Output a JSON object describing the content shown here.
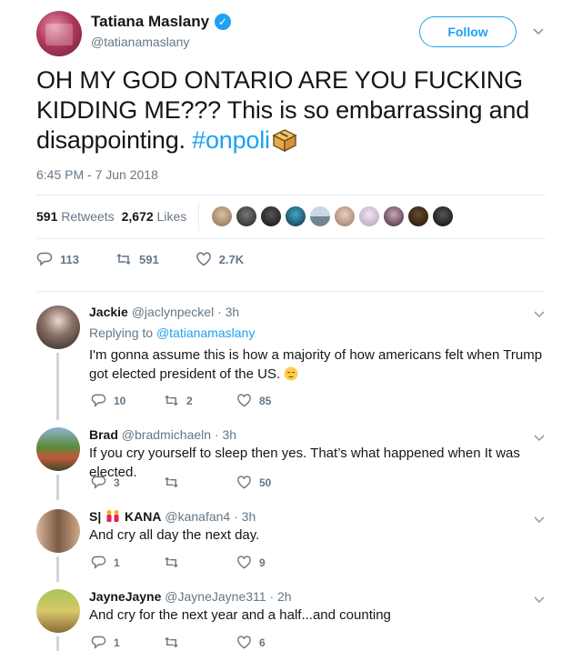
{
  "tweet": {
    "display_name": "Tatiana Maslany",
    "handle": "@tatianamaslany",
    "follow_label": "Follow",
    "text_main": "OH MY GOD ONTARIO ARE YOU FUCKING KIDDING ME??? This is so embarrassing and disappointing. ",
    "hashtag": "#onpoli",
    "timestamp": "6:45 PM - 7 Jun 2018",
    "retweets_count": "591",
    "retweets_label": "Retweets",
    "likes_count": "2,672",
    "likes_label": "Likes",
    "reply_count": "113",
    "retweet_count_action": "591",
    "like_count_action": "2.7K",
    "brand_color": "#1da1f2",
    "verified_icon": "verified-badge-icon",
    "hashtag_emoji": "ballot-box-icon"
  },
  "replies": [
    {
      "name": "Jackie",
      "handle": "@jaclynpeckel",
      "time": "· 3h",
      "replying_prefix": "Replying to",
      "replying_handle": "@tatianamaslany",
      "text": "I'm gonna assume this is how a majority of how americans felt when Trump got elected president of the US. ",
      "replies": "10",
      "retweets": "2",
      "likes": "85"
    },
    {
      "name": "Brad",
      "handle": "@bradmichaeln",
      "time": "· 3h",
      "text": "If you cry yourself to sleep then yes. That’s what happened when It was elected.",
      "replies": "3",
      "retweets": "",
      "likes": "50"
    },
    {
      "name": "S|",
      "name_suffix": "KANA",
      "handle": "@kanafan4",
      "time": "· 3h",
      "text": "And cry all day the next day.",
      "replies": "1",
      "retweets": "",
      "likes": "9"
    },
    {
      "name": "JayneJayne",
      "handle": "@JayneJayne311",
      "time": "· 2h",
      "text": "And cry for the next year and a half...and counting",
      "replies": "1",
      "retweets": "",
      "likes": "6"
    }
  ]
}
